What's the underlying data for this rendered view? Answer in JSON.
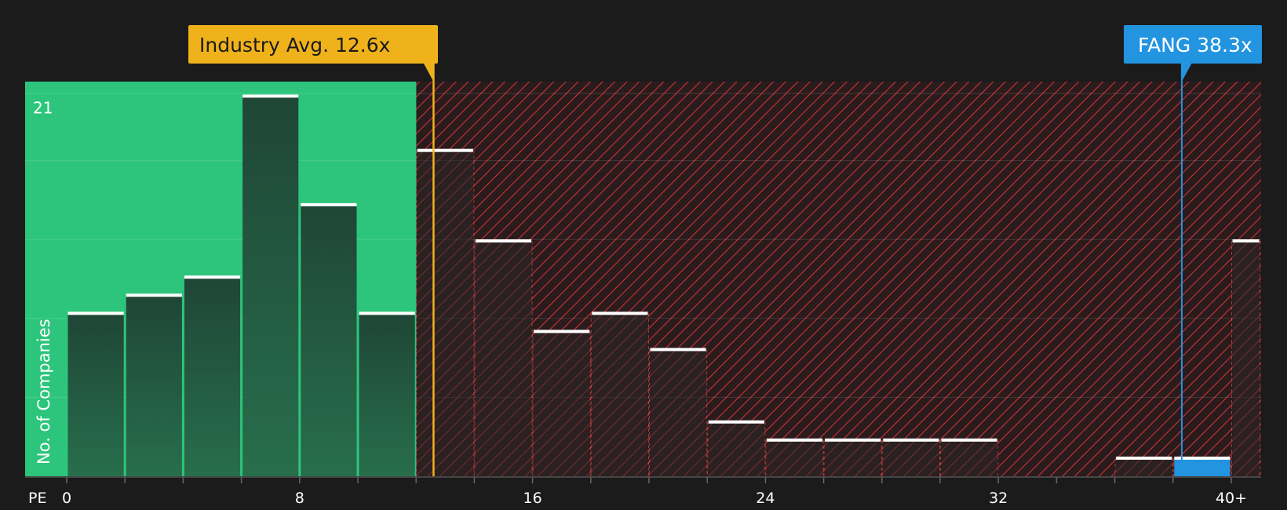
{
  "chart_data": {
    "type": "bar",
    "xlabel": "PE",
    "ylabel": "No. of Companies",
    "ymax_label": "21",
    "ylim": [
      0,
      21.8
    ],
    "x_ticks": [
      "0",
      "8",
      "16",
      "24",
      "32",
      "40+"
    ],
    "bins": [
      {
        "x0": 0,
        "x1": 2,
        "value": 9
      },
      {
        "x0": 2,
        "x1": 4,
        "value": 10
      },
      {
        "x0": 4,
        "x1": 6,
        "value": 11
      },
      {
        "x0": 6,
        "x1": 8,
        "value": 21
      },
      {
        "x0": 8,
        "x1": 10,
        "value": 15
      },
      {
        "x0": 10,
        "x1": 12,
        "value": 9
      },
      {
        "x0": 12,
        "x1": 14,
        "value": 18
      },
      {
        "x0": 14,
        "x1": 16,
        "value": 13
      },
      {
        "x0": 16,
        "x1": 18,
        "value": 8
      },
      {
        "x0": 18,
        "x1": 20,
        "value": 9
      },
      {
        "x0": 20,
        "x1": 22,
        "value": 7
      },
      {
        "x0": 22,
        "x1": 24,
        "value": 3
      },
      {
        "x0": 24,
        "x1": 26,
        "value": 2
      },
      {
        "x0": 26,
        "x1": 28,
        "value": 2
      },
      {
        "x0": 28,
        "x1": 30,
        "value": 2
      },
      {
        "x0": 30,
        "x1": 32,
        "value": 2
      },
      {
        "x0": 32,
        "x1": 34,
        "value": 0
      },
      {
        "x0": 34,
        "x1": 36,
        "value": 0
      },
      {
        "x0": 36,
        "x1": 38,
        "value": 1
      },
      {
        "x0": 38,
        "x1": 40,
        "value": 1,
        "highlight": true
      },
      {
        "x0": 40,
        "x1": 41,
        "value": 13
      }
    ],
    "fair_zone_max": 12.6,
    "industry_avg": {
      "value": 12.6,
      "label": "Industry Avg. 12.6x"
    },
    "company": {
      "value": 38.3,
      "label": "FANG 38.3x"
    },
    "colors": {
      "background": "#1b1b1b",
      "undervalued": "#2dc57c",
      "overvalued_hatch": "#c8353a",
      "industry": "#f0b21b",
      "company": "#2394e0",
      "bar_cap": "#ffffff"
    }
  }
}
